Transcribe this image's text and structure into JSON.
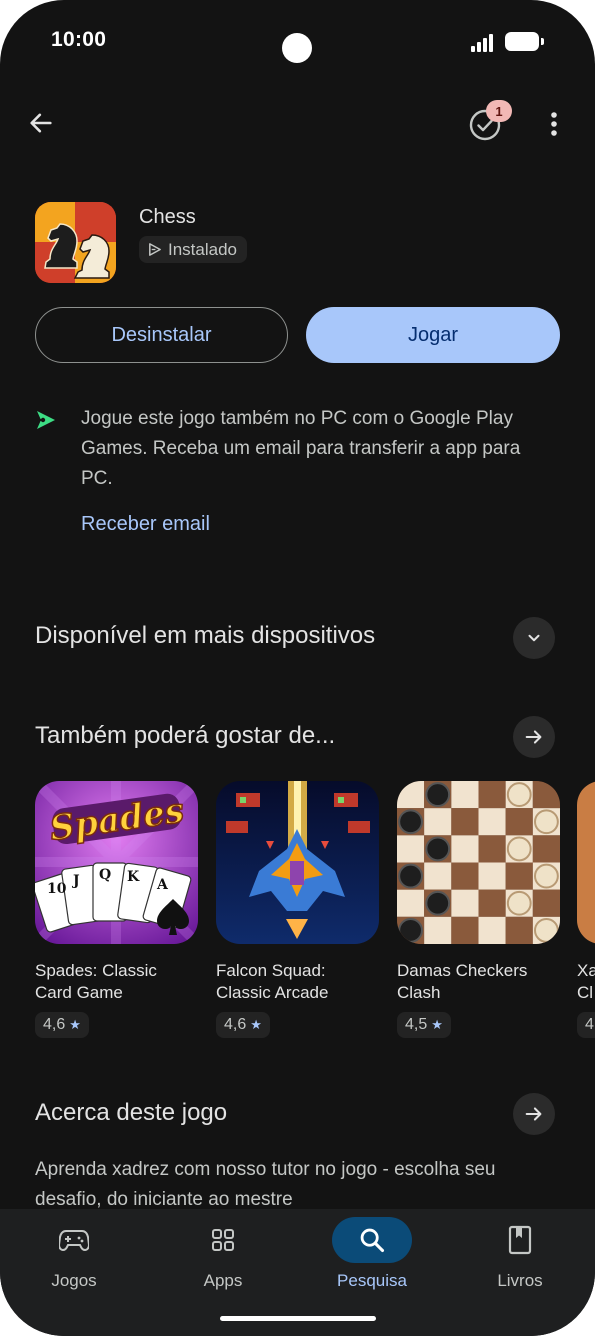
{
  "status": {
    "time": "10:00"
  },
  "header": {
    "notification_count": "1"
  },
  "app": {
    "name": "Chess",
    "installed_label": "Instalado"
  },
  "actions": {
    "uninstall_label": "Desinstalar",
    "play_label": "Jogar"
  },
  "pc_promo": {
    "text": "Jogue este jogo também no PC com o Google Play Games. Receba um email para transferir a app para PC.",
    "link": "Receber email"
  },
  "sections": {
    "devices": "Disponível em mais dispositivos",
    "similar": "Também poderá gostar de...",
    "about": "Acerca deste jogo"
  },
  "similar_apps": [
    {
      "name_line1": "Spades: Classic",
      "name_line2": "Card Game",
      "rating": "4,6",
      "icon": "spades-icon"
    },
    {
      "name_line1": "Falcon Squad:",
      "name_line2": "Classic Arcade",
      "rating": "4,6",
      "icon": "falcon-squad-icon"
    },
    {
      "name_line1": "Damas Checkers",
      "name_line2": "Clash",
      "rating": "4,5",
      "icon": "checkers-icon"
    },
    {
      "name_line1": "Xa",
      "name_line2": "Cl",
      "rating": "4",
      "icon": "partial-app-icon"
    }
  ],
  "about": {
    "description": "Aprenda xadrez com nosso tutor no jogo - escolha seu desafio, do iniciante ao mestre"
  },
  "bottom_nav": [
    {
      "label": "Jogos",
      "icon": "gamepad-icon"
    },
    {
      "label": "Apps",
      "icon": "apps-grid-icon"
    },
    {
      "label": "Pesquisa",
      "icon": "search-icon",
      "active": true
    },
    {
      "label": "Livros",
      "icon": "book-icon"
    }
  ],
  "colors": {
    "background": "#131313",
    "accent": "#a8c7fa",
    "active_nav": "#0b4b78",
    "badge": "#f2b8b5"
  }
}
